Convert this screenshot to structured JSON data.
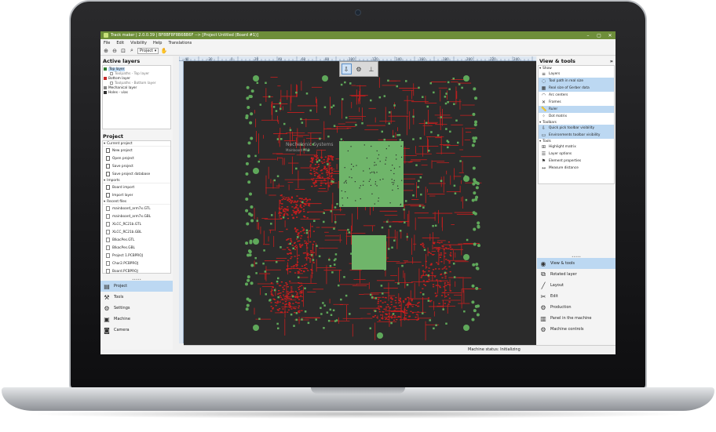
{
  "window": {
    "title": "Track maker | 2.0.0.39 | BF8BF8F8B6BB6F --> [Project Untitled (Board #1)]",
    "controls": [
      "–",
      "▢",
      "✕"
    ]
  },
  "menu": [
    "File",
    "Edit",
    "Visibility",
    "Help",
    "Translations"
  ],
  "toolbar": {
    "project_select": "Project"
  },
  "left_panel": {
    "title": "Active layers",
    "layers": [
      {
        "label": "Top layer",
        "color": "#2f7d32",
        "sub": false,
        "selected": true
      },
      {
        "label": "Toolpaths - Top layer",
        "color": "",
        "sub": true,
        "selected": false
      },
      {
        "label": "Bottom layer",
        "color": "#c62828",
        "sub": false,
        "selected": false
      },
      {
        "label": "Toolpaths - Bottom layer",
        "color": "",
        "sub": true,
        "selected": false
      },
      {
        "label": "Mechanical layer",
        "color": "#888888",
        "sub": false,
        "selected": false
      },
      {
        "label": "Holes - vias",
        "color": "#333333",
        "sub": false,
        "selected": false
      }
    ],
    "project_title": "Project",
    "current_project": {
      "title": "Current project",
      "items": [
        "New project",
        "Open project",
        "Save project",
        "Save project database"
      ]
    },
    "imports": {
      "title": "Imports",
      "items": [
        "Board import",
        "Import layer"
      ]
    },
    "recent": {
      "title": "Recent files",
      "items": [
        "mainboard_arm7x.GTL",
        "mainboard_arm7x.GBL",
        "XLCC_RC21b.GTL",
        "XLCC_RC21b.GBL",
        "BlkacPes.GTL",
        "BlkacPes.GBL",
        "Project 1.PCBPROJ",
        "Char2.PCBPROJ",
        "Board.PCBPROJ"
      ]
    },
    "nav": [
      {
        "label": "Project",
        "icon": "project-icon",
        "active": true
      },
      {
        "label": "Tools",
        "icon": "tools-icon",
        "active": false
      },
      {
        "label": "Settings",
        "icon": "settings-icon",
        "active": false
      },
      {
        "label": "Machine",
        "icon": "machine-icon",
        "active": false
      },
      {
        "label": "Camera",
        "icon": "camera-icon",
        "active": false
      }
    ]
  },
  "canvas": {
    "ruler_labels": [
      "-40",
      "-20",
      "0",
      "20",
      "40",
      "60",
      "80",
      "100",
      "120",
      "140",
      "160",
      "180",
      "200",
      "220",
      "240"
    ],
    "board_text": [
      "Nechelonic Systems",
      "Mainboard PRO"
    ]
  },
  "right_panel": {
    "title": "View & tools",
    "expand": "»",
    "show": {
      "title": "Show",
      "items": [
        {
          "label": "Layers",
          "icon": "layers-icon",
          "on": false
        },
        {
          "label": "Tool path in real size",
          "icon": "toolpath-icon",
          "on": true
        },
        {
          "label": "Real size of Gerber data",
          "icon": "gerber-icon",
          "on": true
        },
        {
          "label": "Arc centers",
          "icon": "arc-icon",
          "on": false
        },
        {
          "label": "Frames",
          "icon": "frames-icon",
          "on": false
        },
        {
          "label": "Ruler",
          "icon": "ruler-icon",
          "on": true
        },
        {
          "label": "Dot matrix",
          "icon": "dot-matrix-icon",
          "on": false
        }
      ]
    },
    "toolbars": {
      "title": "Toolbars",
      "items": [
        {
          "label": "Quick pick toolbar visibility",
          "icon": "quickpick-icon",
          "on": true
        },
        {
          "label": "Environments toolbar visibility",
          "icon": "environment-icon",
          "on": true
        }
      ]
    },
    "tools": {
      "title": "Tools",
      "items": [
        {
          "label": "Highlight matrix",
          "icon": "highlight-icon",
          "on": false
        },
        {
          "label": "Layer options",
          "icon": "layer-options-icon",
          "on": false
        },
        {
          "label": "Element properties",
          "icon": "properties-icon",
          "on": false
        },
        {
          "label": "Measure distance",
          "icon": "measure-icon",
          "on": false
        }
      ]
    },
    "nav": [
      {
        "label": "View & tools",
        "icon": "eye-icon",
        "active": true
      },
      {
        "label": "Rotated layer",
        "icon": "rotated-layer-icon",
        "active": false
      },
      {
        "label": "Layout",
        "icon": "layout-icon",
        "active": false
      },
      {
        "label": "Edit",
        "icon": "edit-icon",
        "active": false
      },
      {
        "label": "Production",
        "icon": "production-icon",
        "active": false
      },
      {
        "label": "Panel in the machine",
        "icon": "panel-icon",
        "active": false
      },
      {
        "label": "Machine controls",
        "icon": "machine-controls-icon",
        "active": false
      }
    ]
  },
  "status": {
    "machine": "Machine status: Initializing"
  }
}
